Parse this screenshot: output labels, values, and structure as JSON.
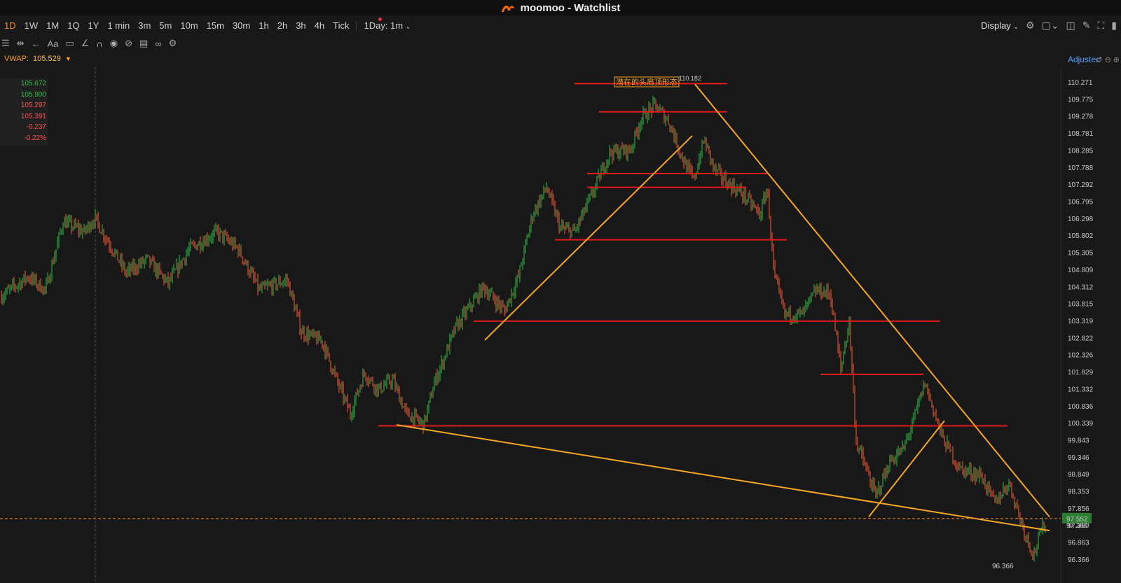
{
  "window": {
    "title": "moomoo - Watchlist",
    "app_logo": "moomoo-logo-icon"
  },
  "timeframes": [
    "1D",
    "1W",
    "1M",
    "1Q",
    "1Y",
    "1 min",
    "3m",
    "5m",
    "10m",
    "15m",
    "30m",
    "1h",
    "2h",
    "3h",
    "4h",
    "Tick"
  ],
  "timeframe_active": "1D",
  "interval_select": "1Day: 1m",
  "display_label": "Display",
  "drawing_tools": [
    "menu-icon",
    "fit-icon",
    "back-arrow-icon",
    "text-icon",
    "comment-icon",
    "line-tool-icon",
    "magnet-icon",
    "eye-icon",
    "hide-icon",
    "trash-icon",
    "link-icon",
    "settings-icon"
  ],
  "vwap": {
    "label": "VWAP:",
    "value": "105.529"
  },
  "info": [
    "105.672",
    "105.900",
    "105.297",
    "105.391",
    "-0.237",
    "-0.22%"
  ],
  "adjusted_label": "Adjustec",
  "annotation": {
    "text": "潜在的头肩顶形态",
    "high": "110.182"
  },
  "low_label": "96.366",
  "current_price": "97.552",
  "partial_price": "97.360",
  "colors": {
    "up": "#2fbf48",
    "down": "#ff5a3c",
    "resistance": "#e21a1a",
    "trend": "#f5a623",
    "accent": "#ff8a1f",
    "link": "#4ea3ff"
  },
  "chart_data": {
    "type": "candlestick",
    "y_ticks": [
      "110.271",
      "109.775",
      "109.278",
      "108.781",
      "108.285",
      "107.788",
      "107.292",
      "106.795",
      "106.298",
      "105.802",
      "105.305",
      "104.809",
      "104.312",
      "103.815",
      "103.319",
      "102.822",
      "102.326",
      "101.829",
      "101.332",
      "100.836",
      "100.339",
      "99.843",
      "99.346",
      "98.849",
      "98.353",
      "97.856",
      "97.360",
      "96.863",
      "96.366"
    ],
    "ylim": [
      96.0,
      110.7
    ],
    "price_path": [
      [
        0,
        104.0
      ],
      [
        40,
        104.6
      ],
      [
        65,
        104.2
      ],
      [
        90,
        106.2
      ],
      [
        120,
        105.9
      ],
      [
        135,
        106.3
      ],
      [
        155,
        105.6
      ],
      [
        180,
        104.7
      ],
      [
        210,
        105.1
      ],
      [
        240,
        104.4
      ],
      [
        270,
        105.4
      ],
      [
        310,
        105.9
      ],
      [
        340,
        105.4
      ],
      [
        370,
        104.2
      ],
      [
        410,
        104.5
      ],
      [
        430,
        103.0
      ],
      [
        460,
        102.7
      ],
      [
        480,
        101.6
      ],
      [
        500,
        100.6
      ],
      [
        520,
        101.8
      ],
      [
        540,
        101.3
      ],
      [
        560,
        101.6
      ],
      [
        580,
        100.6
      ],
      [
        605,
        100.3
      ],
      [
        620,
        101.5
      ],
      [
        650,
        103.1
      ],
      [
        690,
        104.3
      ],
      [
        720,
        103.6
      ],
      [
        740,
        104.6
      ],
      [
        760,
        106.4
      ],
      [
        780,
        107.2
      ],
      [
        800,
        106.0
      ],
      [
        820,
        105.9
      ],
      [
        845,
        107.0
      ],
      [
        870,
        108.2
      ],
      [
        900,
        108.3
      ],
      [
        915,
        109.2
      ],
      [
        935,
        109.6
      ],
      [
        955,
        109.1
      ],
      [
        975,
        108.0
      ],
      [
        990,
        107.4
      ],
      [
        1005,
        108.6
      ],
      [
        1020,
        107.7
      ],
      [
        1040,
        107.3
      ],
      [
        1060,
        107.0
      ],
      [
        1085,
        106.4
      ],
      [
        1095,
        107.2
      ],
      [
        1105,
        104.6
      ],
      [
        1120,
        103.5
      ],
      [
        1145,
        103.5
      ],
      [
        1165,
        104.2
      ],
      [
        1185,
        104.1
      ],
      [
        1200,
        101.9
      ],
      [
        1212,
        103.3
      ],
      [
        1222,
        99.8
      ],
      [
        1250,
        98.2
      ],
      [
        1270,
        99.2
      ],
      [
        1290,
        99.6
      ],
      [
        1305,
        100.5
      ],
      [
        1320,
        101.5
      ],
      [
        1345,
        99.9
      ],
      [
        1370,
        99.0
      ],
      [
        1400,
        98.8
      ],
      [
        1420,
        98.0
      ],
      [
        1440,
        98.6
      ],
      [
        1460,
        97.3
      ],
      [
        1475,
        96.5
      ],
      [
        1490,
        97.4
      ]
    ],
    "resistance_lines": [
      {
        "x1": 820,
        "x2": 1038,
        "price": 110.22
      },
      {
        "x1": 855,
        "x2": 1038,
        "price": 109.4
      },
      {
        "x1": 838,
        "x2": 1095,
        "price": 107.6
      },
      {
        "x1": 838,
        "x2": 1065,
        "price": 107.2
      },
      {
        "x1": 792,
        "x2": 1123,
        "price": 105.67
      },
      {
        "x1": 676,
        "x2": 1342,
        "price": 103.3
      },
      {
        "x1": 1171,
        "x2": 1318,
        "price": 101.75
      },
      {
        "x1": 540,
        "x2": 1438,
        "price": 100.25
      }
    ],
    "trend_lines": [
      {
        "x1": 992,
        "p1": 110.2,
        "x2": 1498,
        "p2": 97.6
      },
      {
        "x1": 566,
        "p1": 100.28,
        "x2": 1498,
        "p2": 97.2
      },
      {
        "x1": 692,
        "p1": 102.75,
        "x2": 988,
        "p2": 108.7
      },
      {
        "x1": 1240,
        "p1": 97.6,
        "x2": 1348,
        "p2": 100.4
      }
    ]
  }
}
